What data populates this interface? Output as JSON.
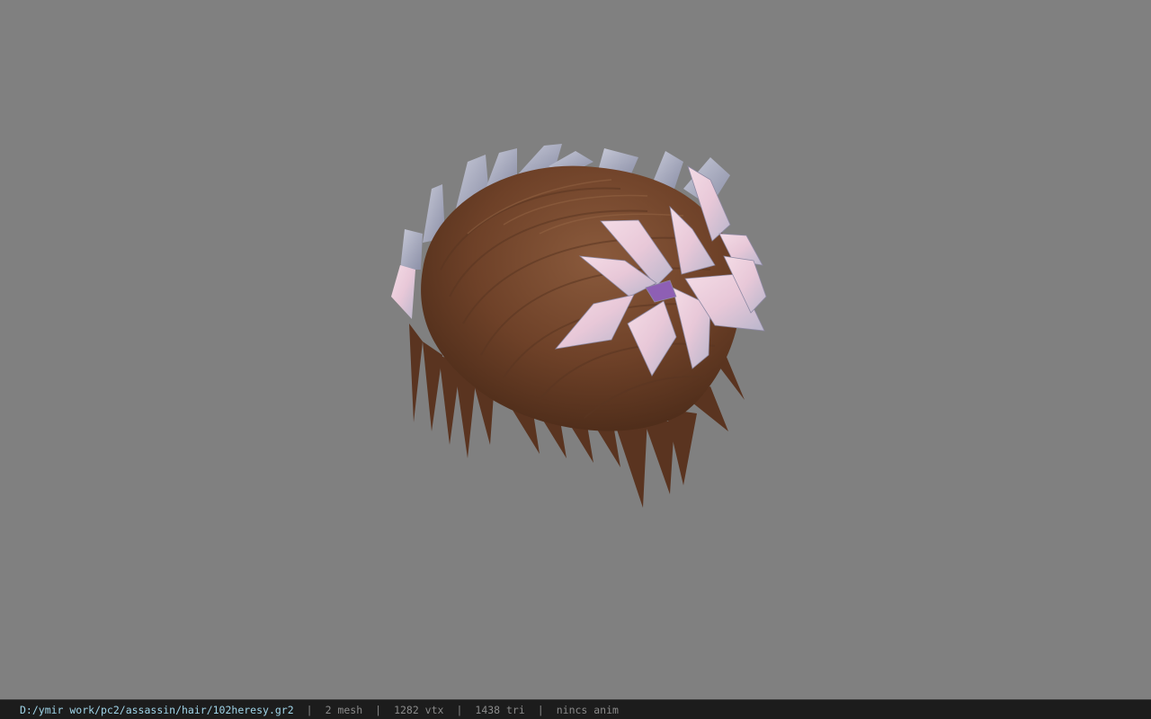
{
  "viewer": {
    "background_color": "#808080",
    "model_name": "hair-with-flower-crown"
  },
  "status_bar": {
    "file_path": "D:/ymir work/pc2/assassin/hair/102heresy.gr2",
    "separator": "|",
    "mesh_count": "2 mesh",
    "vertex_count": "1282 vtx",
    "triangle_count": "1438 tri",
    "animation": "nincs anim",
    "path_color": "#9fd4e8",
    "text_color": "#8a8a8a"
  }
}
